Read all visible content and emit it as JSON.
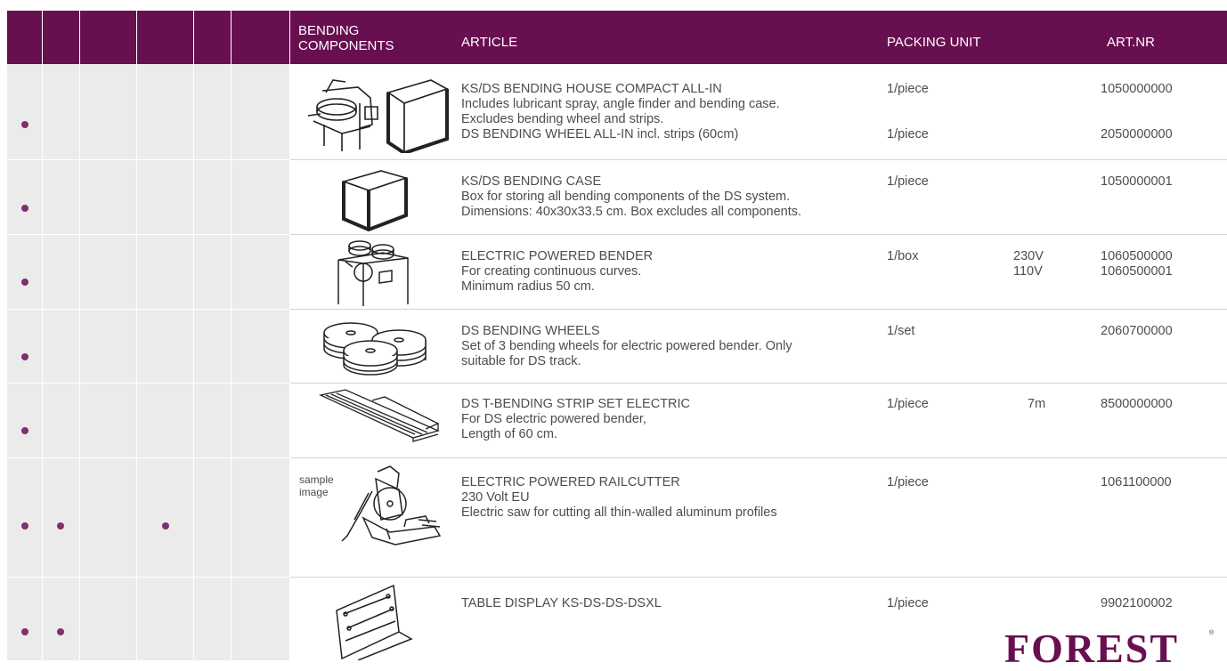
{
  "header": {
    "category": "BENDING\nCOMPONENTS",
    "article": "ARTICLE",
    "packing": "PACKING UNIT",
    "artnr": "ART.NR"
  },
  "rows": [
    {
      "dots": [
        true,
        false,
        false,
        false,
        false,
        false
      ],
      "icon": "bending-house-icon",
      "article": "KS/DS BENDING HOUSE COMPACT ALL-IN\nIncludes lubricant spray, angle finder and bending case.\nExcludes bending wheel and strips.\nDS BENDING WHEEL ALL-IN incl. strips (60cm)",
      "packing": "1/piece\n\n\n1/piece",
      "variant": "",
      "artnr": "1050000000\n\n\n2050000000"
    },
    {
      "dots": [
        true,
        false,
        false,
        false,
        false,
        false
      ],
      "icon": "bending-case-icon",
      "article": "KS/DS BENDING CASE\nBox for storing all bending components of the DS system.\nDimensions: 40x30x33.5 cm. Box excludes all components.",
      "packing": "1/piece",
      "variant": "",
      "artnr": "1050000001"
    },
    {
      "dots": [
        true,
        false,
        false,
        false,
        false,
        false
      ],
      "icon": "electric-bender-icon",
      "article": "ELECTRIC POWERED BENDER\nFor creating continuous curves.\nMinimum radius 50 cm.",
      "packing": "1/box",
      "variant": "230V\n110V",
      "artnr": "1060500000\n1060500001"
    },
    {
      "dots": [
        true,
        false,
        false,
        false,
        false,
        false
      ],
      "icon": "bending-wheels-icon",
      "article": "DS BENDING WHEELS\nSet of 3 bending wheels for electric powered bender. Only\nsuitable for DS track.",
      "packing": "1/set",
      "variant": "",
      "artnr": "2060700000"
    },
    {
      "dots": [
        true,
        false,
        false,
        false,
        false,
        false
      ],
      "icon": "bending-strip-icon",
      "article": "DS T-BENDING STRIP SET ELECTRIC\nFor DS electric powered bender,\nLength of 60 cm.",
      "packing": "1/piece",
      "variant": "7m",
      "artnr": "8500000000"
    },
    {
      "dots": [
        true,
        true,
        false,
        true,
        false,
        false
      ],
      "icon": "railcutter-icon",
      "sample": "sample\nimage",
      "article": "ELECTRIC POWERED RAILCUTTER\n230 Volt EU\nElectric saw for cutting all thin-walled aluminum profiles",
      "packing": "1/piece",
      "variant": "",
      "artnr": "1061100000"
    },
    {
      "dots": [
        true,
        true,
        false,
        false,
        false,
        false
      ],
      "icon": "table-display-icon",
      "article": "TABLE DISPLAY KS-DS-DS-DSXL",
      "packing": "1/piece",
      "variant": "",
      "artnr": "9902100002"
    }
  ],
  "logo": "FOREST",
  "logo_mark": "®",
  "colors": {
    "brand": "#680f50",
    "dot": "#7e2f6e",
    "column_bg": "#ebebeb"
  }
}
